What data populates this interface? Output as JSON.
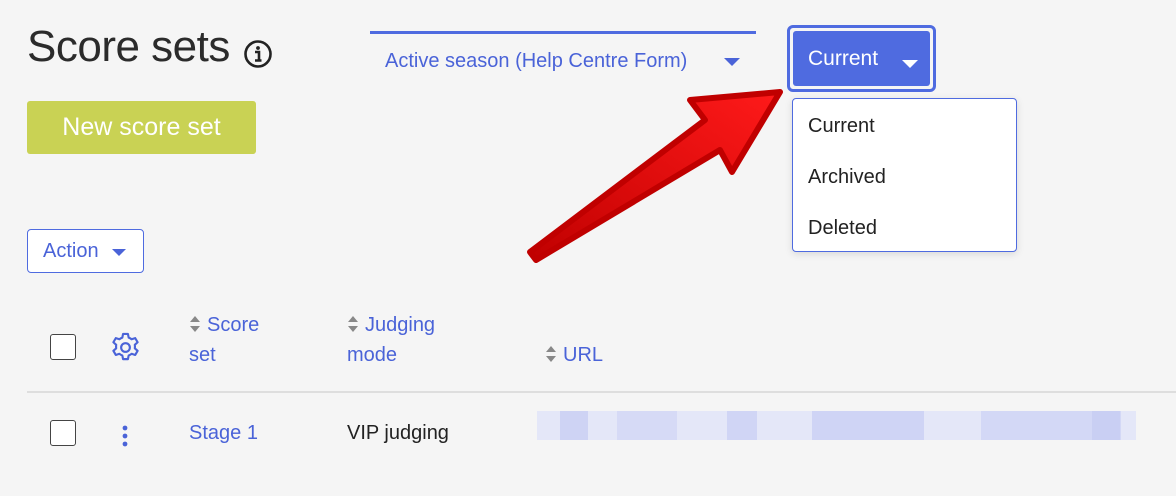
{
  "page": {
    "title": "Score sets",
    "new_button_label": "New score set"
  },
  "filters": {
    "season_label": "Active season (Help Centre Form)",
    "status_button_label": "Current",
    "status_options": [
      "Current",
      "Archived",
      "Deleted"
    ]
  },
  "toolbar": {
    "action_label": "Action"
  },
  "table": {
    "columns": {
      "score_set": [
        "Score",
        "set"
      ],
      "judging_mode": [
        "Judging",
        "mode"
      ],
      "url": "URL"
    },
    "rows": [
      {
        "score_set": "Stage 1",
        "judging_mode": "VIP judging"
      }
    ]
  },
  "colors": {
    "accent": "#4f6be0",
    "new_button": "#c9d254",
    "arrow": "#e00000"
  },
  "icons": [
    "info-icon",
    "chevron-down-icon",
    "gear-icon",
    "sort-icon",
    "kebab-menu-icon",
    "annotation-arrow"
  ]
}
